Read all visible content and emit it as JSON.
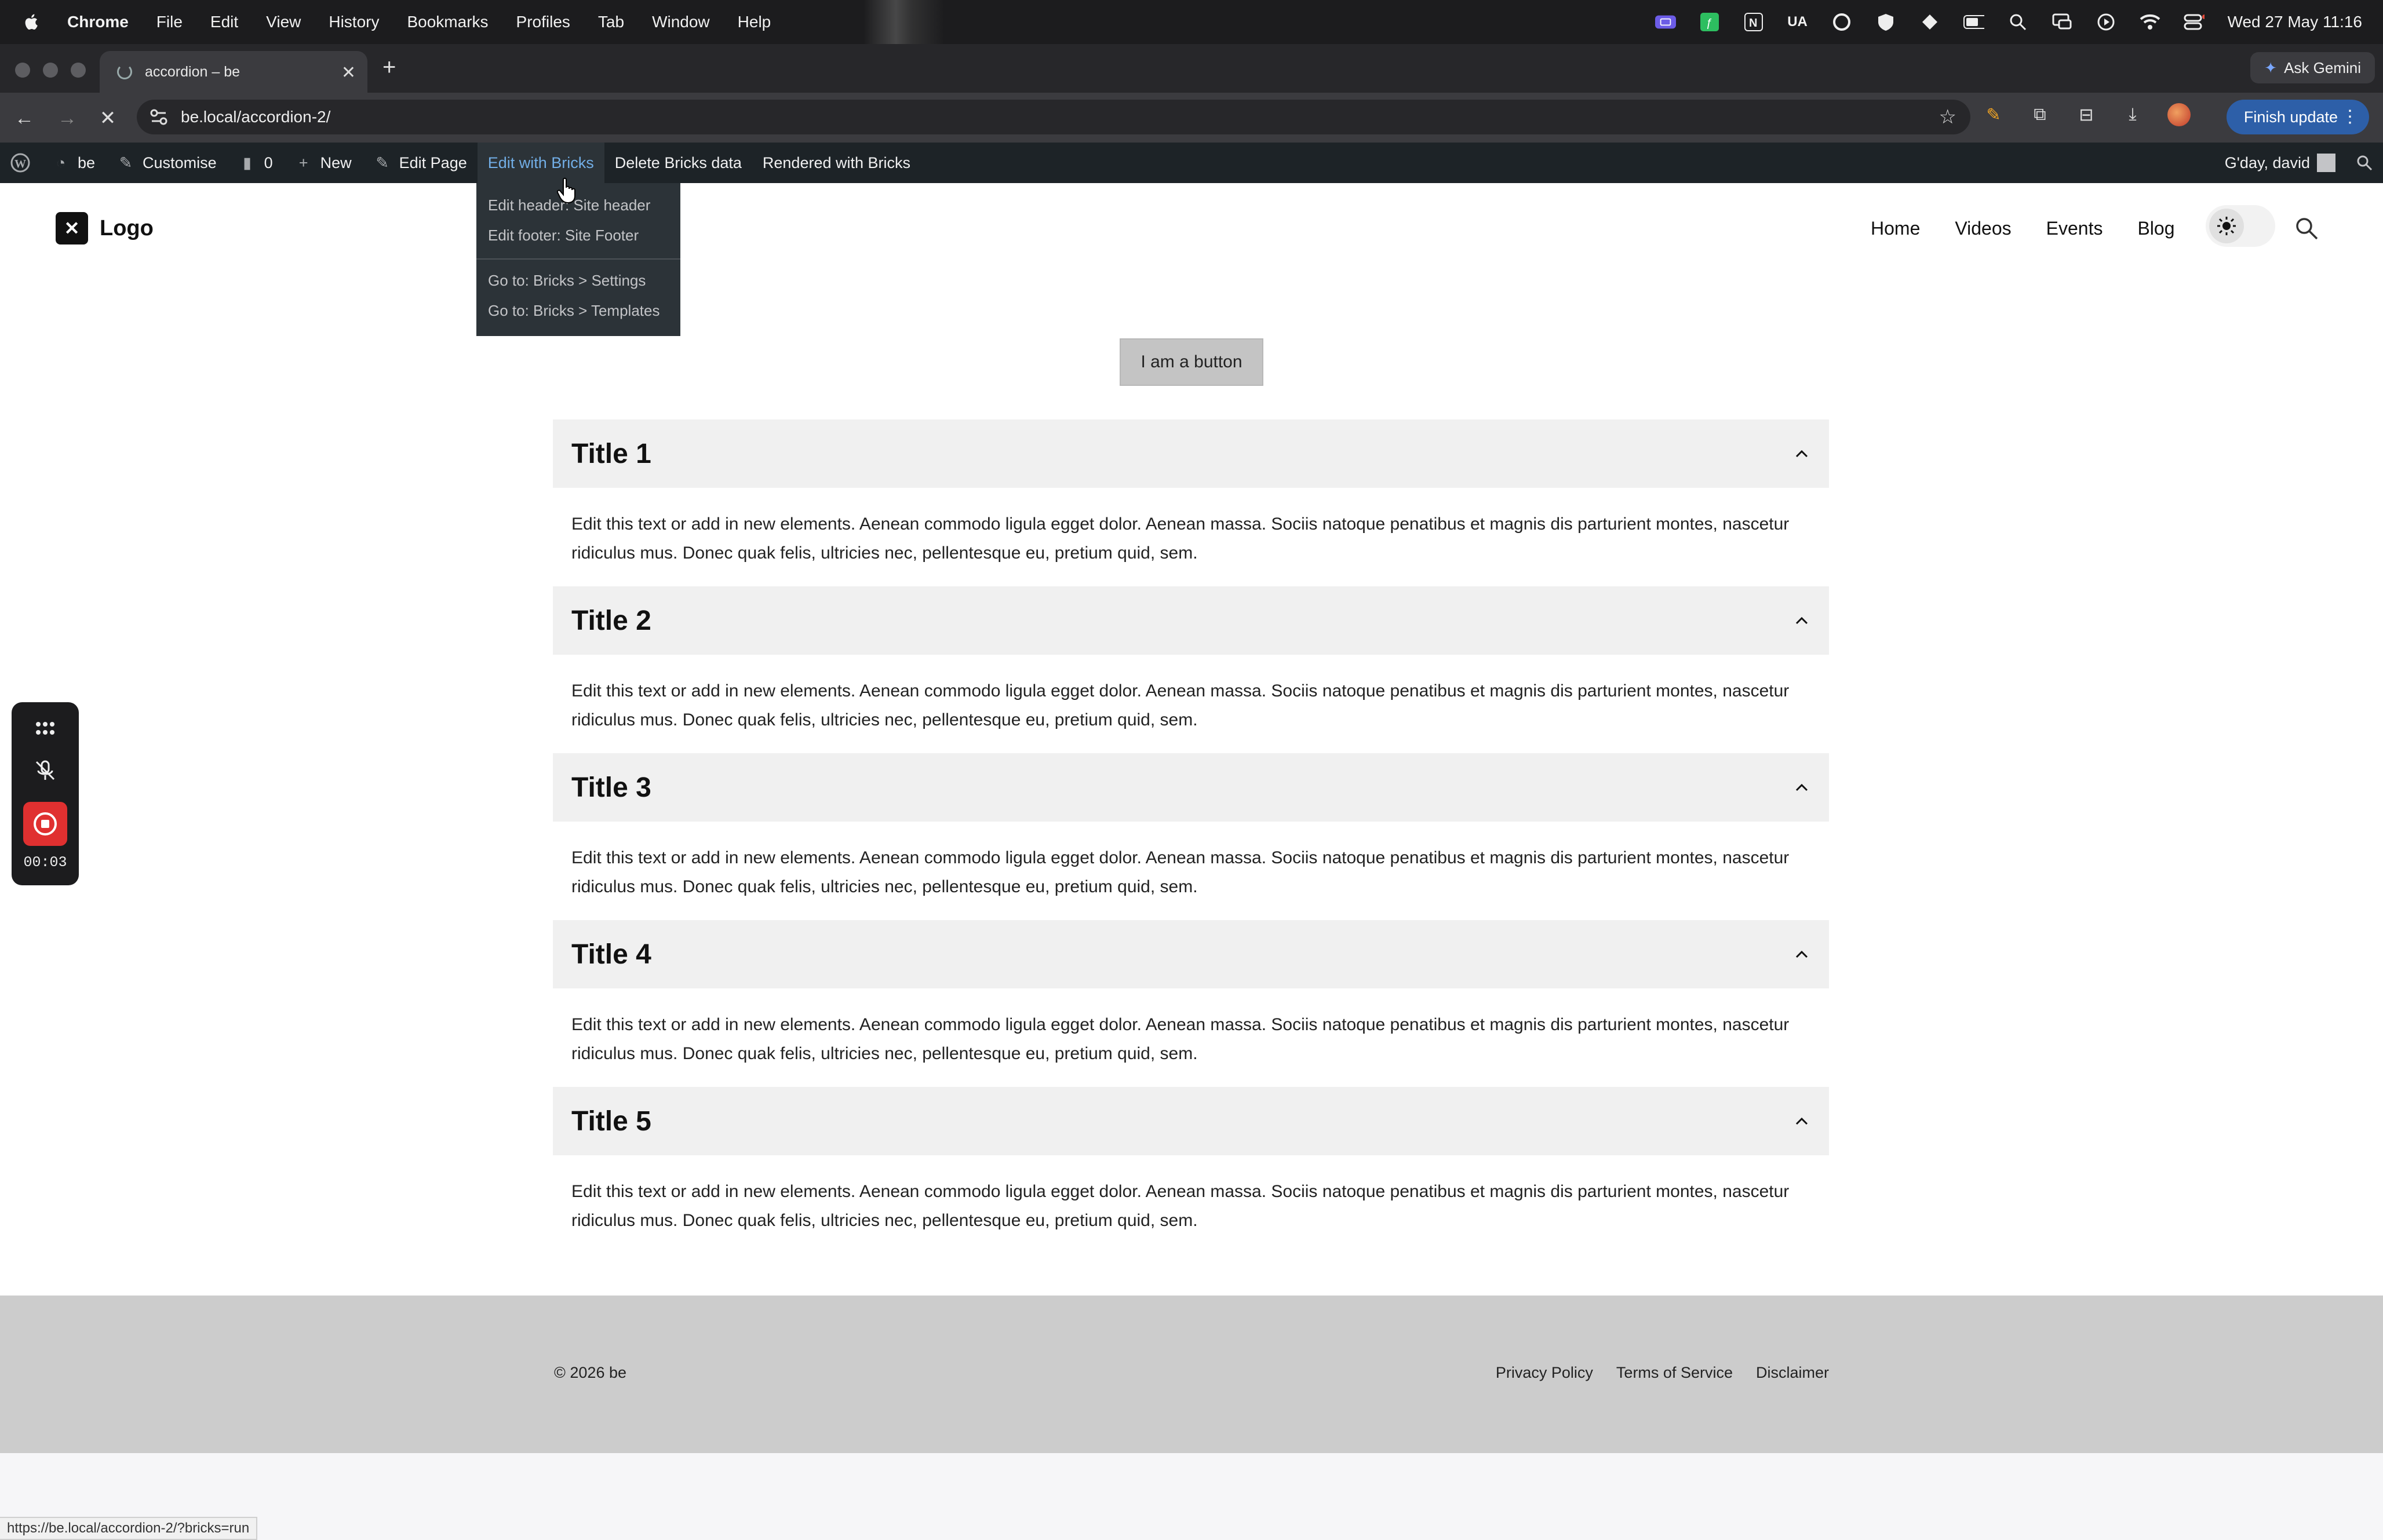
{
  "mac": {
    "app": "Chrome",
    "menu": [
      "File",
      "Edit",
      "View",
      "History",
      "Bookmarks",
      "Profiles",
      "Tab",
      "Window",
      "Help"
    ],
    "status_text": "UA",
    "datetime": "Wed 27 May  11:16"
  },
  "browser": {
    "tab_title": "accordion – be",
    "url": "be.local/accordion-2/",
    "ask_gemini": "Ask Gemini",
    "finish_update": "Finish update",
    "status_url": "https://be.local/accordion-2/?bricks=run"
  },
  "wpbar": {
    "site": "be",
    "customise": "Customise",
    "comments": "0",
    "new": "New",
    "edit_page": "Edit Page",
    "edit_bricks": "Edit with Bricks",
    "delete_bricks": "Delete Bricks data",
    "rendered": "Rendered with Bricks",
    "greeting": "G'day, david"
  },
  "dropdown": {
    "items": [
      "Edit header: Site header",
      "Edit footer: Site Footer",
      "Go to: Bricks > Settings",
      "Go to: Bricks > Templates"
    ]
  },
  "site": {
    "logo": "Logo",
    "nav": [
      "Home",
      "Videos",
      "Events",
      "Blog"
    ],
    "button": "I am a button"
  },
  "accordion": [
    {
      "title": "Title 1",
      "line1": "Edit this text or add in new elements. Aenean commodo ligula egget dolor. Aenean massa. Sociis natoque penatibus et magnis dis parturient montes, nascetur",
      "line2": "ridiculus mus. Donec quak felis, ultricies nec, pellentesque eu, pretium quid, sem."
    },
    {
      "title": "Title 2",
      "line1": "Edit this text or add in new elements. Aenean commodo ligula egget dolor. Aenean massa. Sociis natoque penatibus et magnis dis parturient montes, nascetur",
      "line2": "ridiculus mus. Donec quak felis, ultricies nec, pellentesque eu, pretium quid, sem."
    },
    {
      "title": "Title 3",
      "line1": "Edit this text or add in new elements. Aenean commodo ligula egget dolor. Aenean massa. Sociis natoque penatibus et magnis dis parturient montes, nascetur",
      "line2": "ridiculus mus. Donec quak felis, ultricies nec, pellentesque eu, pretium quid, sem."
    },
    {
      "title": "Title 4",
      "line1": "Edit this text or add in new elements. Aenean commodo ligula egget dolor. Aenean massa. Sociis natoque penatibus et magnis dis parturient montes, nascetur",
      "line2": "ridiculus mus. Donec quak felis, ultricies nec, pellentesque eu, pretium quid, sem."
    },
    {
      "title": "Title 5",
      "line1": "Edit this text or add in new elements. Aenean commodo ligula egget dolor. Aenean massa. Sociis natoque penatibus et magnis dis parturient montes, nascetur",
      "line2": "ridiculus mus. Donec quak felis, ultricies nec, pellentesque eu, pretium quid, sem."
    }
  ],
  "footer": {
    "copyright": "© 2026 be",
    "links": [
      "Privacy Policy",
      "Terms of Service",
      "Disclaimer"
    ]
  },
  "recorder": {
    "time": "00:03"
  },
  "colors": {
    "wp_admin_bg": "#1d2327",
    "active_link": "#72aee6",
    "record_red": "#e03030",
    "finish_update_blue": "#2d5fa8"
  }
}
